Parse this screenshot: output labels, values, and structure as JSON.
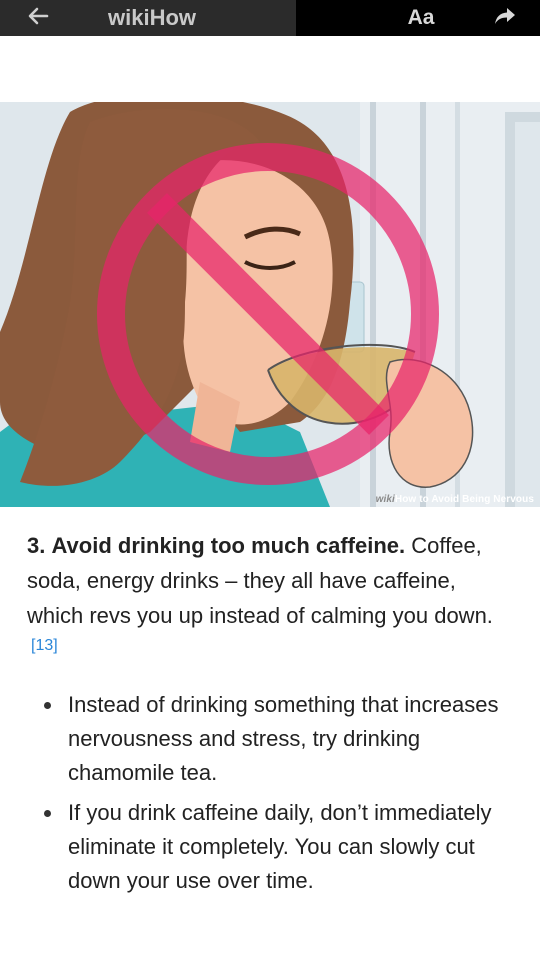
{
  "topbar": {
    "title": "wikiHow",
    "font_button_label": "Aa",
    "back_icon": "arrow-left-icon",
    "share_icon": "share-arrow-icon"
  },
  "image": {
    "watermark_brand_wiki": "wiki",
    "watermark_brand_how": "How",
    "watermark_title": " to Avoid Being Nervous"
  },
  "step": {
    "number": "3.",
    "headline": "Avoid drinking too much caffeine.",
    "body": "Coffee, soda, energy drinks – they all have caffeine, which revs you up instead of calming you down.",
    "reference": "[13]"
  },
  "bullets": [
    "Instead of drinking something that increases nervousness and stress, try drinking chamomile tea.",
    "If you drink caffeine daily, don’t immediately eliminate it completely. You can slowly cut down your use over time."
  ]
}
